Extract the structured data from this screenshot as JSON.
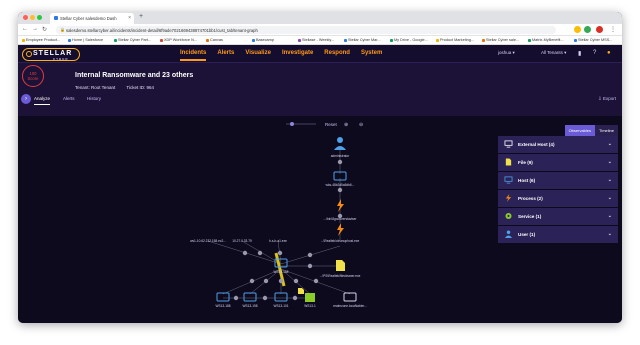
{
  "browser": {
    "tab_title": "Stellar Cyber salesdemo Dash",
    "new_tab": "+",
    "url": "salesdemo.stellarcyber.ai/incidents/incident-detail/6f9ade7021669438874701bb1/cust_tab/tenant-graph",
    "bookmarks": [
      "Employee Product...",
      "Home | Salesforce",
      "Stellar Cyber Part...",
      "XDP Workforce N...",
      "Canvas",
      "Basecamp",
      "Stellase - Weekly...",
      "Stellar Cyber Mar...",
      "My Drive - Google...",
      "Product Marketing...",
      "Stellar Cyber sale...",
      "Matrix-MyBenefit...",
      "Stellar Cyber MSS..."
    ],
    "colors": {
      "close": "#ff5f57",
      "min": "#febc2e",
      "max": "#28c840",
      "ext1": "#d93025",
      "ext2": "#34a853",
      "ext3": "#fbbc04"
    }
  },
  "app": {
    "logo_text": "STELLAR",
    "logo_sub": "CYBER",
    "nav": [
      "Incidents",
      "Alerts",
      "Visualize",
      "Investigate",
      "Respond",
      "System"
    ],
    "active_nav": "Incidents",
    "user": "joshua ▾",
    "tenant": "All Tenants ▾",
    "accent": "#ff9a1a"
  },
  "incident": {
    "score_value": "100",
    "score_label": "Score",
    "title": "Internal Ransomware and 23 others",
    "tenant": "Tenant:  Root Tenant",
    "ticket": "Ticket ID:  964",
    "tabs": [
      "Analyze",
      "Alerts",
      "History"
    ],
    "active_tab": "Analyze",
    "export": "Export"
  },
  "graph": {
    "toolbar": {
      "reset": "Reset"
    },
    "node_labels": {
      "user": "administrator",
      "host_top": "wks-48b2d5a5db6...",
      "proc_top": "...\\bin\\8goouverstaviser",
      "proc_mid": "...\\Realtek\\cleanuphost.exe",
      "ext1": "ws1-10.62.232.158.ec2...",
      "ext2": "10.27.0.33.79",
      "ext3": "h-s-b-a1.exe",
      "ext4": "...\\Realtek\\cleanuphost.exe",
      "hub": "WS13.168",
      "file_right": "...\\PS\\Realtek\\filecleaner.exe",
      "b1": "WS13-188",
      "b2": "WS13-198",
      "b3": "WS13-101",
      "b4": "WS13-1",
      "b5": "realmzone.local\\tabler..."
    },
    "colors": {
      "host": "#4ea0e8",
      "file": "#f0e04a",
      "process": "#f28a16",
      "service": "#8ccc26",
      "edge": "#6a6880",
      "edge_highlight": "#d8c21c"
    }
  },
  "panel": {
    "tabs": [
      "Observables",
      "Timeline"
    ],
    "active_tab": "Observables",
    "items": [
      {
        "label": "External Host (4)",
        "icon": "monitor-icon"
      },
      {
        "label": "File (9)",
        "icon": "file-icon"
      },
      {
        "label": "Host (6)",
        "icon": "monitor-icon"
      },
      {
        "label": "Process (2)",
        "icon": "process-bolt-icon"
      },
      {
        "label": "Service (1)",
        "icon": "gear-icon"
      },
      {
        "label": "User (1)",
        "icon": "user-icon"
      }
    ]
  }
}
